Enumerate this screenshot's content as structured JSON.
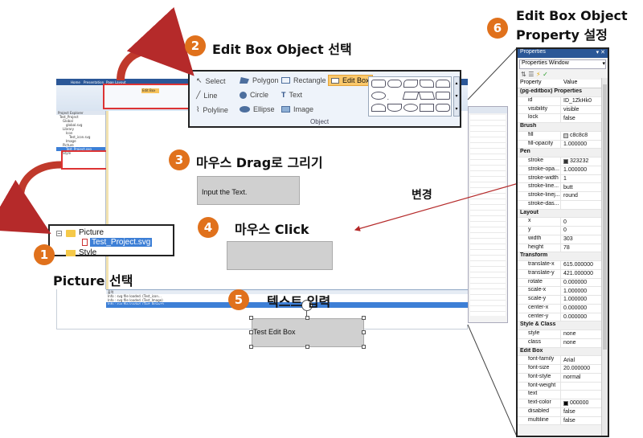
{
  "callouts": {
    "step1": {
      "num": "1",
      "title": "Picture 선택"
    },
    "step2": {
      "num": "2",
      "title": "Edit Box Object 선택"
    },
    "step3": {
      "num": "3",
      "title": "마우스 Drag로 그리기"
    },
    "step4": {
      "num": "4",
      "title": "마우스 Click"
    },
    "step5": {
      "num": "5",
      "title": "텍스트 입력"
    },
    "step6": {
      "num": "6",
      "title_line1": "Edit Box Object",
      "title_line2": "Property 설정"
    },
    "change_label": "변경"
  },
  "ribbon_zoom": {
    "items": {
      "select": "Select",
      "line": "Line",
      "polyline": "Polyline",
      "polygon": "Polygon",
      "circle": "Circle",
      "ellipse": "Ellipse",
      "rectangle": "Rectangle",
      "text": "Text",
      "image": "Image",
      "edit_box": "Edit Box"
    },
    "group_label": "Object"
  },
  "mini_app": {
    "tabs": [
      "Home",
      "Presentation",
      "Page Layout"
    ],
    "edit_box_tab": "Edit Box",
    "tree_header": "Project Explorer",
    "tree_items": [
      "Test_Project",
      "Global",
      "global.svg",
      "Library",
      "Icon",
      "Test_icon.svg",
      "Image",
      "Picture",
      "Test_Project.svg",
      "Style"
    ],
    "output_lines": [
      "Info : svg file loaded. (Test_icon...",
      "Info : svg file loaded. (Test_Image)",
      "Info : svg file loaded. (Test_Project)"
    ],
    "output_label": "출력"
  },
  "tree_zoom": {
    "folder_label": "Picture",
    "file_label": "Test_Project.svg",
    "style_label": "Style"
  },
  "canvas": {
    "drag_box_text": "Input the Text.",
    "test_box_text": "Test Edit Box"
  },
  "properties": {
    "window_title": "Properties",
    "dropdown": "Properties Window",
    "col_property": "Property",
    "col_value": "Value",
    "rows": [
      {
        "cat": "(pg-editbox) Properties"
      },
      {
        "k": "id",
        "v": "ID_1ZkHk0"
      },
      {
        "k": "visibility",
        "v": "visible"
      },
      {
        "k": "lock",
        "v": "false"
      },
      {
        "cat": "Brush"
      },
      {
        "k": "fill",
        "v": "c8c8c8",
        "swatch": "#c8c8c8"
      },
      {
        "k": "fill-opacity",
        "v": "1.000000"
      },
      {
        "cat": "Pen"
      },
      {
        "k": "stroke",
        "v": "323232",
        "swatch": "#323232"
      },
      {
        "k": "stroke-opa...",
        "v": "1.000000"
      },
      {
        "k": "stroke-width",
        "v": "1"
      },
      {
        "k": "stroke-line...",
        "v": "butt"
      },
      {
        "k": "stroke-linej...",
        "v": "round"
      },
      {
        "k": "stroke-das...",
        "v": ""
      },
      {
        "cat": "Layout"
      },
      {
        "k": "x",
        "v": "0"
      },
      {
        "k": "y",
        "v": "0"
      },
      {
        "k": "width",
        "v": "303"
      },
      {
        "k": "height",
        "v": "78"
      },
      {
        "cat": "Transform"
      },
      {
        "k": "translate-x",
        "v": "615.000000"
      },
      {
        "k": "translate-y",
        "v": "421.000000"
      },
      {
        "k": "rotate",
        "v": "0.000000"
      },
      {
        "k": "scale-x",
        "v": "1.000000"
      },
      {
        "k": "scale-y",
        "v": "1.000000"
      },
      {
        "k": "center-x",
        "v": "0.000000"
      },
      {
        "k": "center-y",
        "v": "0.000000"
      },
      {
        "cat": "Style & Class"
      },
      {
        "k": "style",
        "v": "none"
      },
      {
        "k": "class",
        "v": "none"
      },
      {
        "cat": "Edit Box"
      },
      {
        "k": "font-family",
        "v": "Arial"
      },
      {
        "k": "font-size",
        "v": "20.000000"
      },
      {
        "k": "font-style",
        "v": "normal"
      },
      {
        "k": "font-weight",
        "v": ""
      },
      {
        "k": "text",
        "v": ""
      },
      {
        "k": "text-color",
        "v": "000000",
        "swatch": "#000000"
      },
      {
        "k": "disabled",
        "v": "false"
      },
      {
        "k": "multiline",
        "v": "false"
      }
    ]
  },
  "colors": {
    "callout": "#e0711c",
    "arrow": "#b52a2a",
    "edit_box_fill": "#c8c8c8"
  }
}
